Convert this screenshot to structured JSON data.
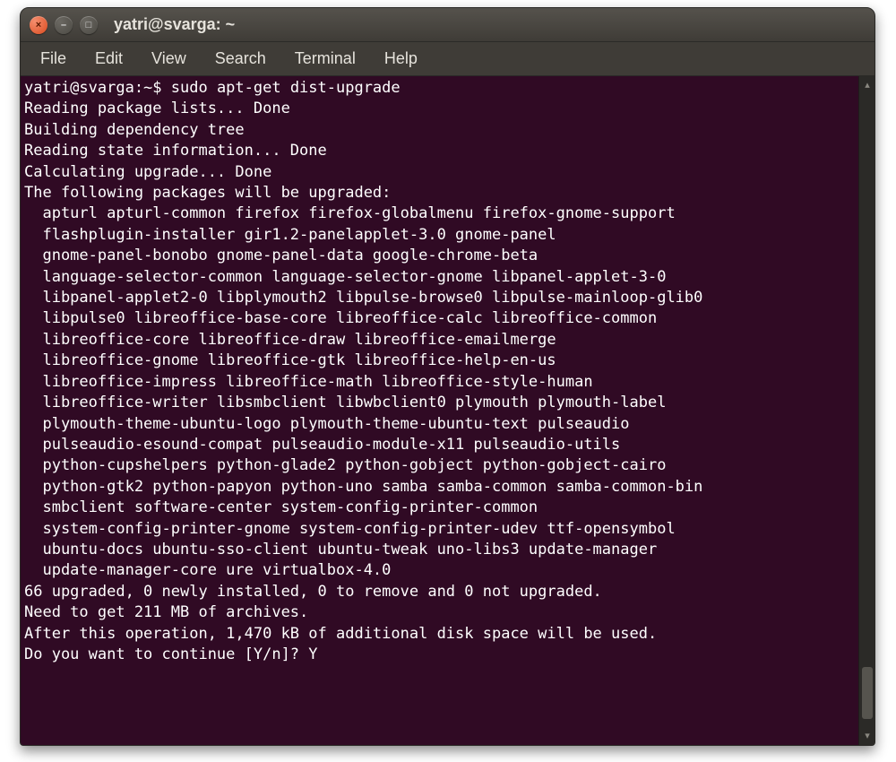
{
  "window": {
    "title": "yatri@svarga: ~"
  },
  "window_controls": {
    "close": "×",
    "minimize": "–",
    "maximize": "□"
  },
  "menubar": [
    "File",
    "Edit",
    "View",
    "Search",
    "Terminal",
    "Help"
  ],
  "terminal": {
    "prompt": "yatri@svarga:~$ ",
    "command": "sudo apt-get dist-upgrade",
    "pre_lines": [
      "Reading package lists... Done",
      "Building dependency tree",
      "Reading state information... Done",
      "Calculating upgrade... Done",
      "The following packages will be upgraded:"
    ],
    "package_lines": [
      "apturl apturl-common firefox firefox-globalmenu firefox-gnome-support",
      "flashplugin-installer gir1.2-panelapplet-3.0 gnome-panel",
      "gnome-panel-bonobo gnome-panel-data google-chrome-beta",
      "language-selector-common language-selector-gnome libpanel-applet-3-0",
      "libpanel-applet2-0 libplymouth2 libpulse-browse0 libpulse-mainloop-glib0",
      "libpulse0 libreoffice-base-core libreoffice-calc libreoffice-common",
      "libreoffice-core libreoffice-draw libreoffice-emailmerge",
      "libreoffice-gnome libreoffice-gtk libreoffice-help-en-us",
      "libreoffice-impress libreoffice-math libreoffice-style-human",
      "libreoffice-writer libsmbclient libwbclient0 plymouth plymouth-label",
      "plymouth-theme-ubuntu-logo plymouth-theme-ubuntu-text pulseaudio",
      "pulseaudio-esound-compat pulseaudio-module-x11 pulseaudio-utils",
      "python-cupshelpers python-glade2 python-gobject python-gobject-cairo",
      "python-gtk2 python-papyon python-uno samba samba-common samba-common-bin",
      "smbclient software-center system-config-printer-common",
      "system-config-printer-gnome system-config-printer-udev ttf-opensymbol",
      "ubuntu-docs ubuntu-sso-client ubuntu-tweak uno-libs3 update-manager",
      "update-manager-core ure virtualbox-4.0"
    ],
    "post_lines": [
      "66 upgraded, 0 newly installed, 0 to remove and 0 not upgraded.",
      "Need to get 211 MB of archives.",
      "After this operation, 1,470 kB of additional disk space will be used.",
      "Do you want to continue [Y/n]? Y"
    ]
  }
}
